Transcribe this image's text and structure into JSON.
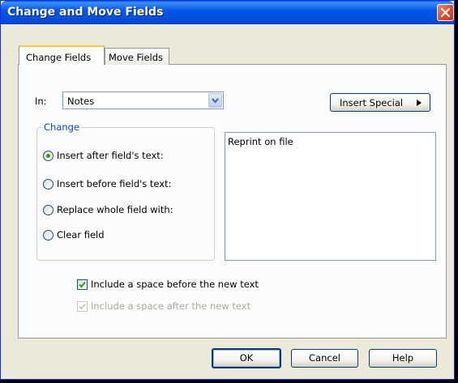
{
  "window": {
    "title": "Change and Move Fields"
  },
  "tabs": [
    {
      "label": "Change Fields",
      "active": true
    },
    {
      "label": "Move Fields",
      "active": false
    }
  ],
  "in_field": {
    "label": "In:",
    "value": "Notes"
  },
  "insert_special_label": "Insert Special",
  "change_group": {
    "title": "Change",
    "options": [
      {
        "label": "Insert after field's text:",
        "checked": true
      },
      {
        "label": "Insert before field's text:",
        "checked": false
      },
      {
        "label": "Replace whole field with:",
        "checked": false
      },
      {
        "label": "Clear field",
        "checked": false
      }
    ]
  },
  "text_value": "Reprint on file",
  "checkboxes": [
    {
      "label": "Include a space before the new text",
      "checked": true,
      "enabled": true
    },
    {
      "label": "Include a space after the new text",
      "checked": true,
      "enabled": false
    }
  ],
  "buttons": {
    "ok": "OK",
    "cancel": "Cancel",
    "help": "Help"
  },
  "colors": {
    "titlebar": "#0558E8",
    "close": "#E1542D",
    "group_title": "#0046D5",
    "dialog_bg": "#ECE9D8"
  },
  "icons": {
    "close": "close-icon",
    "dropdown": "chevron-down-icon",
    "insert_special": "triangle-right-icon"
  }
}
